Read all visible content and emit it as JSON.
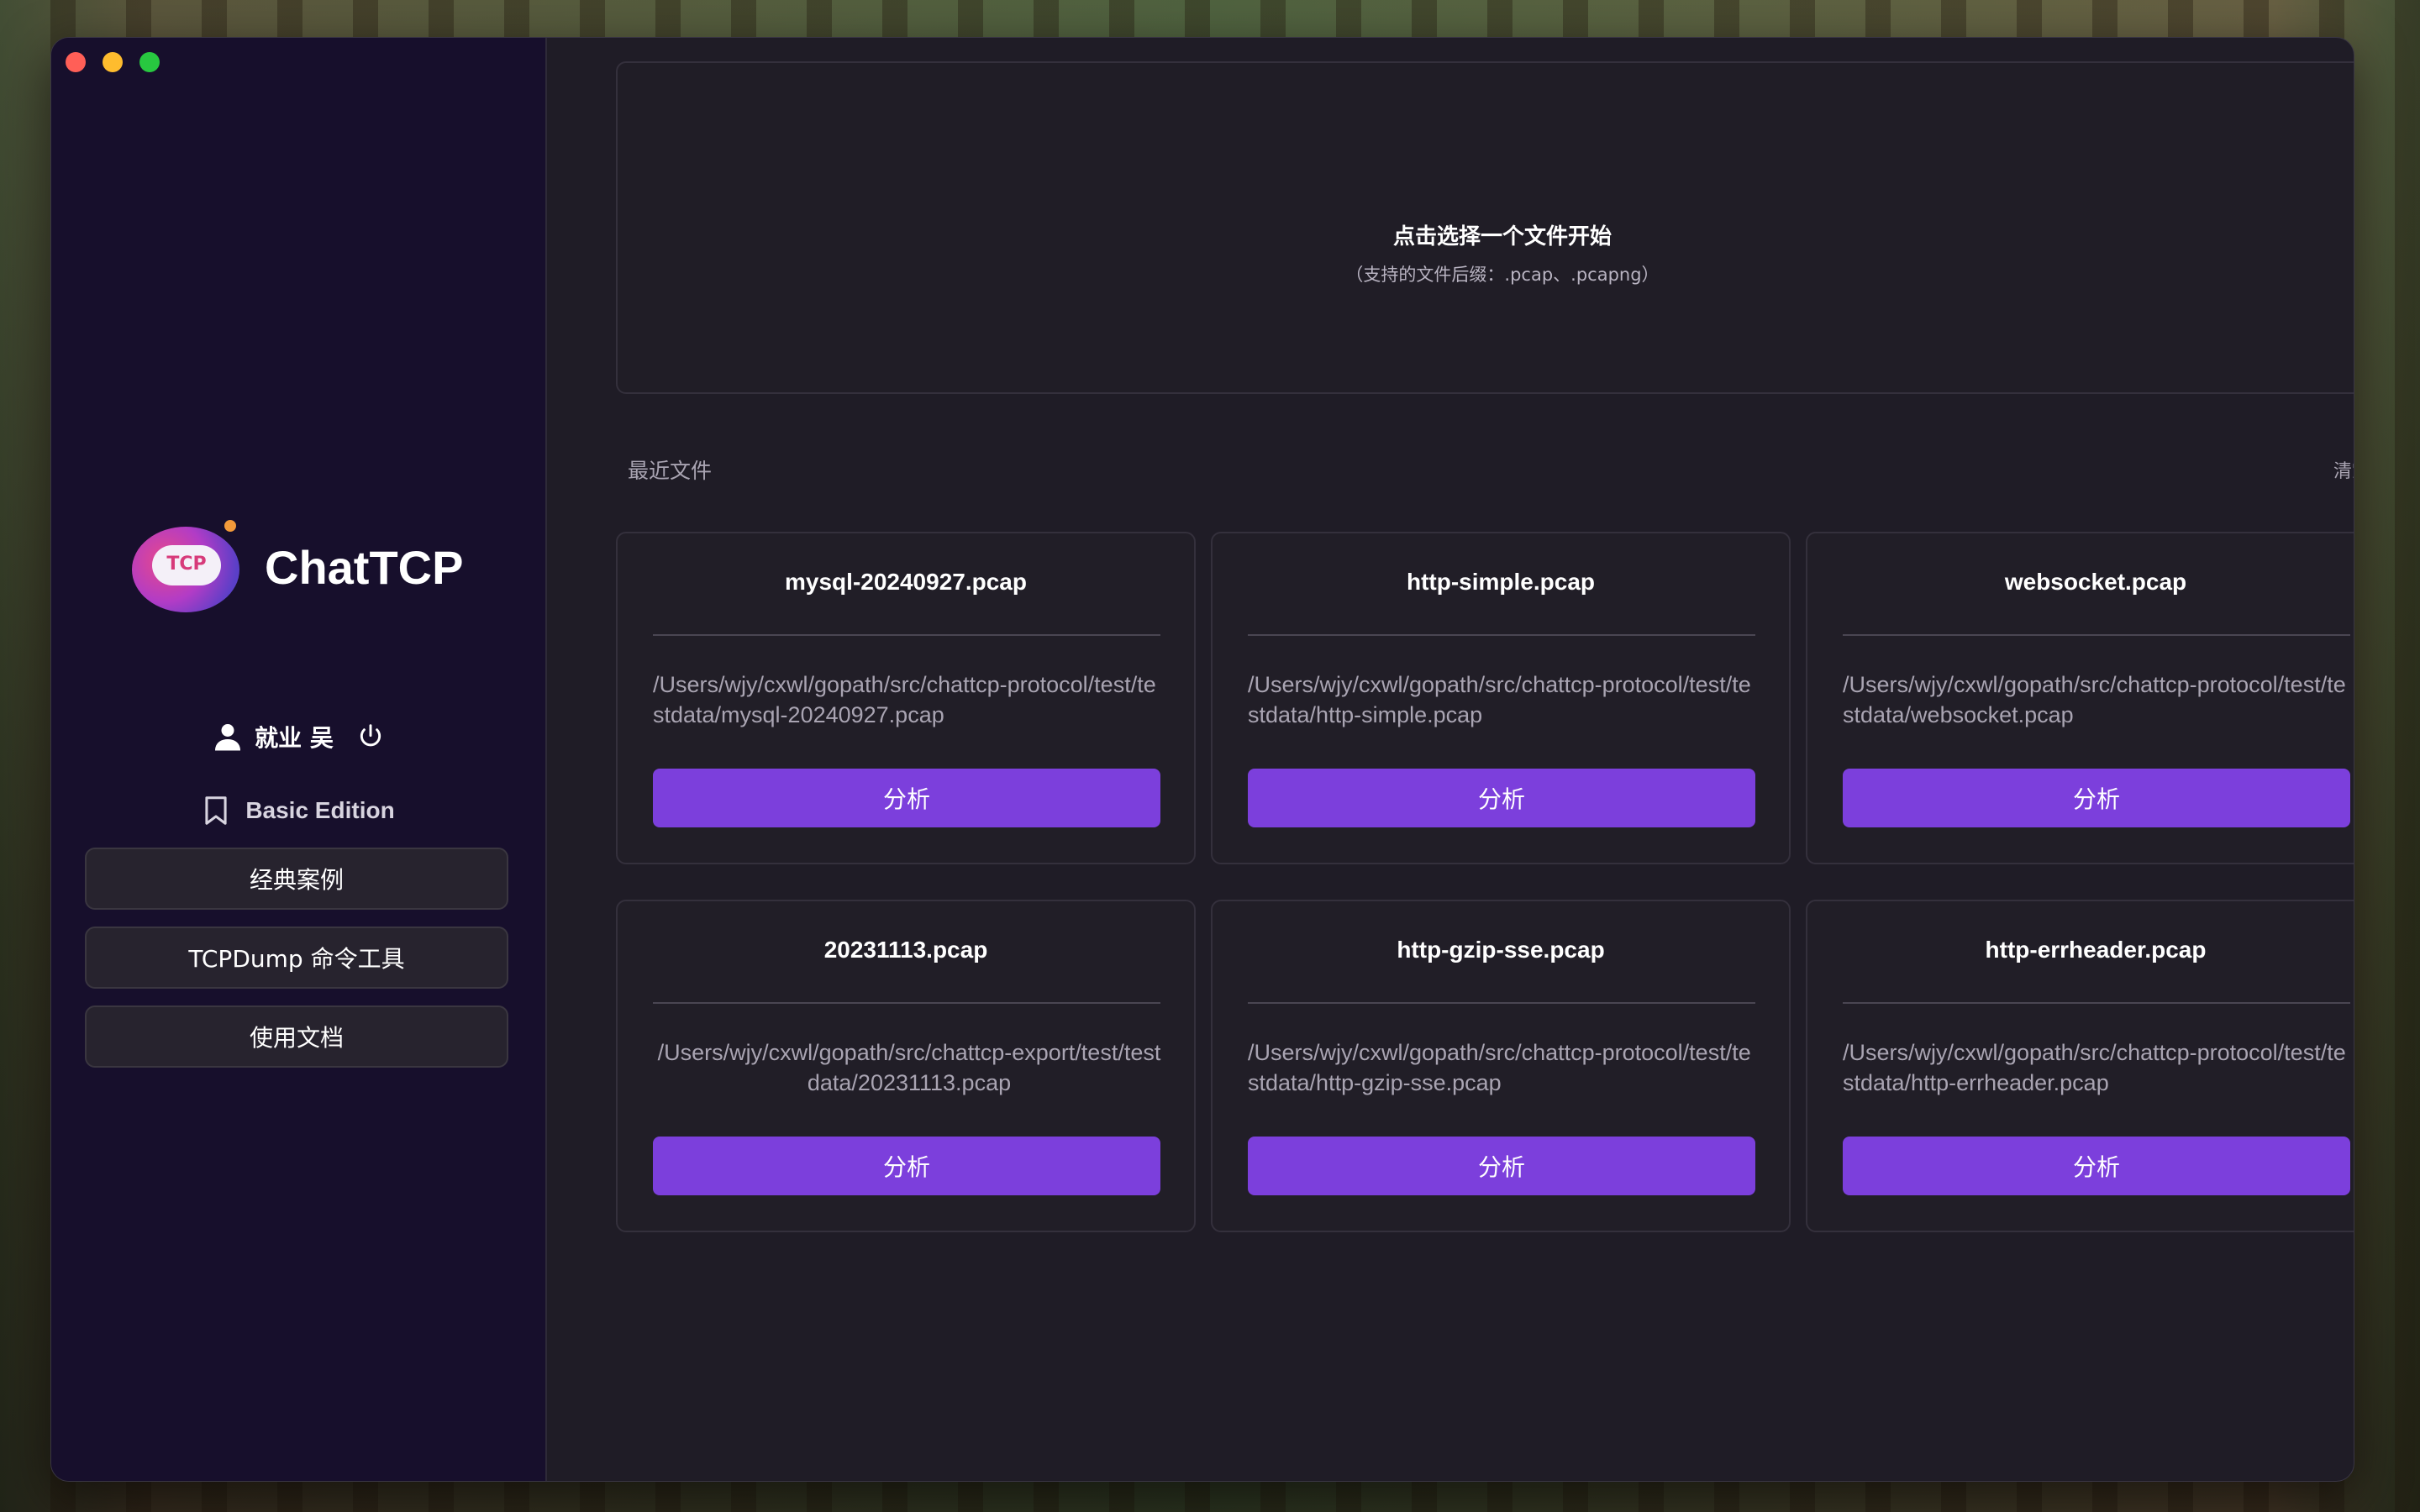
{
  "window": {
    "brand": "ChatTCP",
    "logo_text": "TCP"
  },
  "sidebar": {
    "user_name": "就业 吴",
    "edition": "Basic Edition",
    "nav": [
      {
        "label": "经典案例"
      },
      {
        "label": "TCPDump 命令工具"
      },
      {
        "label": "使用文档"
      }
    ]
  },
  "dropzone": {
    "title": "点击选择一个文件开始",
    "subtitle": "（支持的文件后缀：.pcap、.pcapng）"
  },
  "recent": {
    "title": "最近文件",
    "clear_label": "清空",
    "analyze_label": "分析",
    "files": [
      {
        "name": "mysql-20240927.pcap",
        "path": "/Users/wjy/cxwl/gopath/src/chattcp-protocol/test/testdata/mysql-20240927.pcap"
      },
      {
        "name": "http-simple.pcap",
        "path": "/Users/wjy/cxwl/gopath/src/chattcp-protocol/test/testdata/http-simple.pcap"
      },
      {
        "name": "websocket.pcap",
        "path": "/Users/wjy/cxwl/gopath/src/chattcp-protocol/test/testdata/websocket.pcap"
      },
      {
        "name": "20231113.pcap",
        "path": "/Users/wjy/cxwl/gopath/src/chattcp-export/test/testdata/20231113.pcap"
      },
      {
        "name": "http-gzip-sse.pcap",
        "path": "/Users/wjy/cxwl/gopath/src/chattcp-protocol/test/testdata/http-gzip-sse.pcap"
      },
      {
        "name": "http-errheader.pcap",
        "path": "/Users/wjy/cxwl/gopath/src/chattcp-protocol/test/testdata/http-errheader.pcap"
      }
    ]
  },
  "colors": {
    "accent": "#7c3fdc",
    "sidebar_bg": "#170f2c",
    "main_bg": "#1f1c26"
  }
}
